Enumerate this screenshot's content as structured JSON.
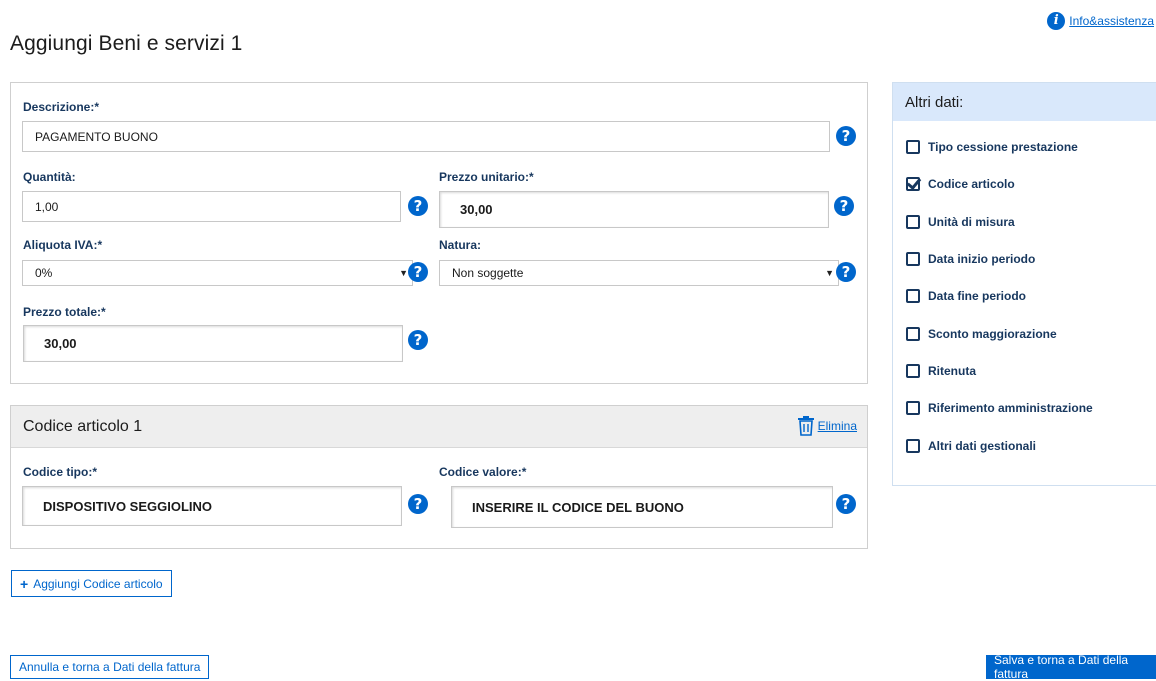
{
  "header": {
    "title": "Aggiungi Beni e servizi 1",
    "info_label": "Info&assistenza"
  },
  "item": {
    "descrizione": {
      "label": "Descrizione:*",
      "value": "PAGAMENTO BUONO"
    },
    "quantita": {
      "label": "Quantità:",
      "value": "1,00"
    },
    "prezzo_unitario": {
      "label": "Prezzo unitario:*",
      "value": "30,00"
    },
    "aliquota_iva": {
      "label": "Aliquota IVA:*",
      "value": "0%"
    },
    "natura": {
      "label": "Natura:",
      "value": "Non soggette"
    },
    "prezzo_totale": {
      "label": "Prezzo totale:*",
      "value": "30,00"
    }
  },
  "codice_articolo": {
    "title": "Codice articolo 1",
    "delete_label": "Elimina",
    "codice_tipo": {
      "label": "Codice tipo:*",
      "value": "DISPOSITIVO SEGGIOLINO"
    },
    "codice_valore": {
      "label": "Codice valore:*",
      "value": "INSERIRE IL CODICE DEL BUONO"
    }
  },
  "altri_dati": {
    "title": "Altri dati:",
    "options": [
      {
        "label": "Tipo cessione prestazione",
        "checked": false
      },
      {
        "label": "Codice articolo",
        "checked": true
      },
      {
        "label": "Unità di misura",
        "checked": false
      },
      {
        "label": "Data inizio periodo",
        "checked": false
      },
      {
        "label": "Data fine periodo",
        "checked": false
      },
      {
        "label": "Sconto maggiorazione",
        "checked": false
      },
      {
        "label": "Ritenuta",
        "checked": false
      },
      {
        "label": "Riferimento amministrazione",
        "checked": false
      },
      {
        "label": "Altri dati gestionali",
        "checked": false
      }
    ]
  },
  "buttons": {
    "add_code": "Aggiungi Codice articolo",
    "cancel": "Annulla e torna a Dati della fattura",
    "save": "Salva e torna a Dati della fattura"
  },
  "help_glyph": "?",
  "colors": {
    "accent": "#0066cc",
    "label": "#17375e",
    "side_header": "#d9e8fb"
  }
}
